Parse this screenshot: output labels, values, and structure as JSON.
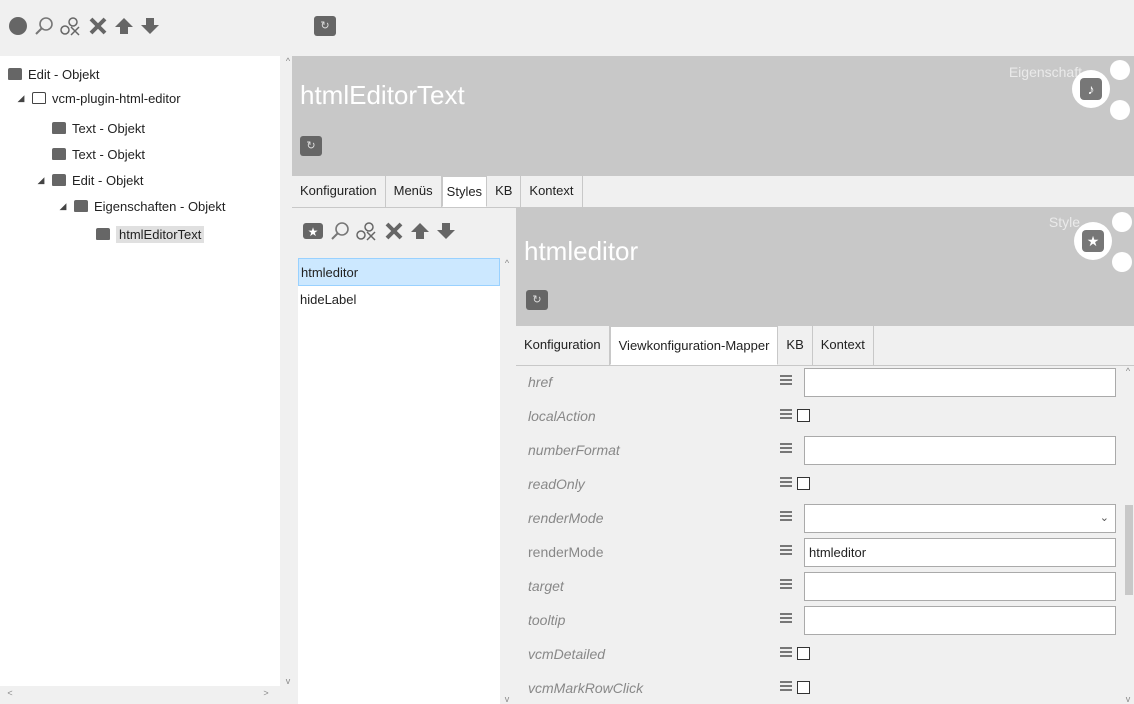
{
  "left_toolbar": {
    "icons": [
      "circle-icon",
      "search-icon",
      "ox-icon",
      "delete-icon",
      "arrow-up-icon",
      "arrow-down-icon"
    ]
  },
  "tree": {
    "items": [
      {
        "label": "Edit - Objekt",
        "level": 0,
        "expanded": null,
        "icon": "book-icon"
      },
      {
        "label": "vcm-plugin-html-editor",
        "level": 1,
        "expanded": true,
        "icon": "open-book-icon"
      },
      {
        "label": "Text - Objekt",
        "level": 2,
        "expanded": null,
        "icon": "book-icon"
      },
      {
        "label": "Text - Objekt",
        "level": 2,
        "expanded": null,
        "icon": "book-icon"
      },
      {
        "label": "Edit - Objekt",
        "level": 2,
        "expanded": true,
        "icon": "book-icon"
      },
      {
        "label": "Eigenschaften - Objekt",
        "level": 3,
        "expanded": true,
        "icon": "book-icon"
      },
      {
        "label": "htmlEditorText",
        "level": 4,
        "expanded": null,
        "icon": "book-icon",
        "selected": true
      }
    ]
  },
  "object": {
    "title": "htmlEditorText",
    "type_label": "Eigenschaft"
  },
  "tabs1": [
    "Konfiguration",
    "Menüs",
    "Styles",
    "KB",
    "Kontext"
  ],
  "tabs1_active": "Styles",
  "styles_toolbar": {
    "icons": [
      "star-book-icon",
      "search-icon",
      "ox-icon",
      "delete-icon",
      "arrow-up-icon",
      "arrow-down-icon"
    ]
  },
  "styles_list": [
    {
      "label": "htmleditor",
      "selected": true
    },
    {
      "label": "hideLabel",
      "selected": false
    }
  ],
  "style": {
    "title": "htmleditor",
    "type_label": "Style"
  },
  "tabs2": [
    "Konfiguration",
    "Viewkonfiguration-Mapper",
    "KB",
    "Kontext"
  ],
  "tabs2_active": "Viewkonfiguration-Mapper",
  "properties": [
    {
      "name": "href",
      "italic": true,
      "kind": "text",
      "value": ""
    },
    {
      "name": "localAction",
      "italic": true,
      "kind": "checkbox",
      "checked": false
    },
    {
      "name": "numberFormat",
      "italic": true,
      "kind": "text",
      "value": ""
    },
    {
      "name": "readOnly",
      "italic": true,
      "kind": "checkbox",
      "checked": false
    },
    {
      "name": "renderMode",
      "italic": true,
      "kind": "select",
      "value": ""
    },
    {
      "name": "renderMode",
      "italic": false,
      "kind": "text",
      "value": "htmleditor"
    },
    {
      "name": "target",
      "italic": true,
      "kind": "text",
      "value": ""
    },
    {
      "name": "tooltip",
      "italic": true,
      "kind": "text",
      "value": ""
    },
    {
      "name": "vcmDetailed",
      "italic": true,
      "kind": "checkbox",
      "checked": false
    },
    {
      "name": "vcmMarkRowClick",
      "italic": true,
      "kind": "checkbox",
      "checked": false
    }
  ],
  "scroll_glyphs": {
    "up": "^",
    "down": "v",
    "left": "<",
    "right": ">"
  },
  "select_caret": "⌄",
  "colors": {
    "header_gray": "#c8c8c8",
    "selection_blue": "#cce8ff",
    "background": "#f0f0f0"
  }
}
